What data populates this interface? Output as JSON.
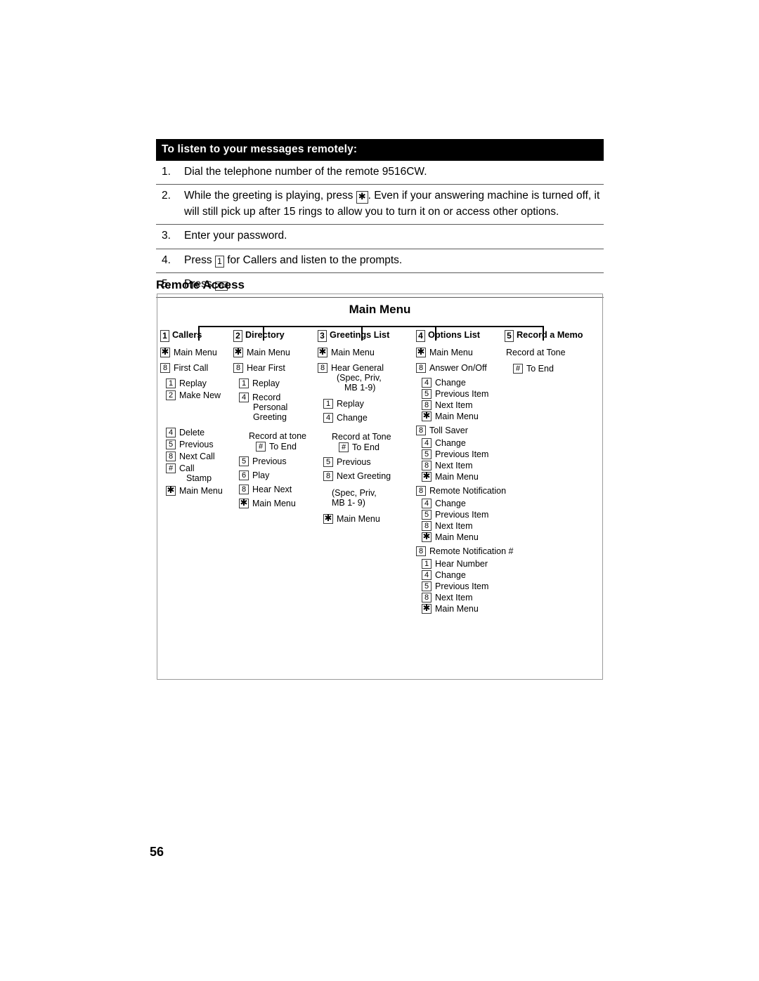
{
  "procedure": {
    "title": "To listen to your messages remotely:",
    "steps": [
      {
        "num": "1.",
        "pre": "Dial the telephone number of the remote 9516CW.",
        "key": "",
        "post": ""
      },
      {
        "num": "2.",
        "pre": "While the greeting is playing, press ",
        "key": "✱",
        "post": ".  Even if your answering machine is turned off, it will still pick up after 15 rings to allow you to turn it on or access other options."
      },
      {
        "num": "3.",
        "pre": "Enter your password.",
        "key": "",
        "post": ""
      },
      {
        "num": "4.",
        "pre": "Press ",
        "key": "1",
        "post": " for Callers and listen to the prompts."
      },
      {
        "num": "5.",
        "pre": "Press ",
        "key": "Rls",
        "post": "."
      }
    ]
  },
  "section": {
    "title": "Remote Access"
  },
  "diagram": {
    "root": "Main Menu",
    "columns": [
      {
        "key": "1",
        "head": "Callers",
        "items": [
          {
            "type": "entry",
            "key": "✱",
            "label": "Main Menu",
            "indent": 0,
            "gap": 8
          },
          {
            "type": "entry",
            "key": "8",
            "label": "First Call",
            "indent": 0,
            "gap": 8
          },
          {
            "type": "entry",
            "key": "1",
            "label": "Replay",
            "indent": 8,
            "gap": 3
          },
          {
            "type": "entry",
            "key": "2",
            "label": "Make New",
            "indent": 8,
            "gap": 3
          },
          {
            "type": "spacer",
            "height": 36
          },
          {
            "type": "entry",
            "key": "4",
            "label": "Delete",
            "indent": 8,
            "gap": 3
          },
          {
            "type": "entry",
            "key": "5",
            "label": "Previous",
            "indent": 8,
            "gap": 3
          },
          {
            "type": "entry",
            "key": "8",
            "label": "Next Call",
            "indent": 8,
            "gap": 3
          },
          {
            "type": "entry",
            "key": "#",
            "label": "Call",
            "indent": 8,
            "gap": 0
          },
          {
            "type": "plain",
            "text": "Stamp",
            "indent": 37,
            "gap": 4
          },
          {
            "type": "entry",
            "key": "✱",
            "label": "Main Menu",
            "indent": 8,
            "gap": 3
          }
        ]
      },
      {
        "key": "2",
        "head": "Directory",
        "items": [
          {
            "type": "entry",
            "key": "✱",
            "label": "Main Menu",
            "indent": 0,
            "gap": 8
          },
          {
            "type": "entry",
            "key": "8",
            "label": "Hear First",
            "indent": 0,
            "gap": 8
          },
          {
            "type": "entry",
            "key": "1",
            "label": "Replay",
            "indent": 8,
            "gap": 6
          },
          {
            "type": "entry",
            "key": "4",
            "label": "Record",
            "indent": 8,
            "gap": 0
          },
          {
            "type": "plain",
            "text": "Personal",
            "indent": 28,
            "gap": 0
          },
          {
            "type": "plain",
            "text": "Greeting",
            "indent": 28,
            "gap": 13
          },
          {
            "type": "plain",
            "text": "Record at tone",
            "indent": 22,
            "gap": 1
          },
          {
            "type": "entry",
            "key": "#",
            "label": "To End",
            "indent": 32,
            "gap": 7
          },
          {
            "type": "entry",
            "key": "5",
            "label": "Previous",
            "indent": 8,
            "gap": 6
          },
          {
            "type": "entry",
            "key": "6",
            "label": "Play",
            "indent": 8,
            "gap": 6
          },
          {
            "type": "entry",
            "key": "8",
            "label": "Hear Next",
            "indent": 8,
            "gap": 6
          },
          {
            "type": "entry",
            "key": "✱",
            "label": "Main Menu",
            "indent": 8,
            "gap": 0
          }
        ]
      },
      {
        "key": "3",
        "head": "Greetings List",
        "items": [
          {
            "type": "entry",
            "key": "✱",
            "label": "Main Menu",
            "indent": 0,
            "gap": 8
          },
          {
            "type": "entry",
            "key": "8",
            "label": "Hear General",
            "indent": 0,
            "gap": 0
          },
          {
            "type": "plain",
            "text": "(Spec, Priv,",
            "indent": 27,
            "gap": 0
          },
          {
            "type": "plain",
            "text": "MB 1-9)",
            "indent": 38,
            "gap": 9
          },
          {
            "type": "entry",
            "key": "1",
            "label": "Replay",
            "indent": 8,
            "gap": 6
          },
          {
            "type": "entry",
            "key": "4",
            "label": "Change",
            "indent": 8,
            "gap": 13
          },
          {
            "type": "plain",
            "text": "Record at Tone",
            "indent": 20,
            "gap": 1
          },
          {
            "type": "entry",
            "key": "#",
            "label": "To End",
            "indent": 30,
            "gap": 7
          },
          {
            "type": "entry",
            "key": "5",
            "label": "Previous",
            "indent": 8,
            "gap": 6
          },
          {
            "type": "entry",
            "key": "8",
            "label": "Next Greeting",
            "indent": 8,
            "gap": 10
          },
          {
            "type": "plain",
            "text": "(Spec, Priv,",
            "indent": 20,
            "gap": 0
          },
          {
            "type": "plain",
            "text": "MB 1- 9)",
            "indent": 20,
            "gap": 9
          },
          {
            "type": "entry",
            "key": "✱",
            "label": "Main Menu",
            "indent": 8,
            "gap": 0
          }
        ]
      },
      {
        "key": "4",
        "head": "Options List",
        "items": [
          {
            "type": "entry",
            "key": "✱",
            "label": "Main Menu",
            "indent": 0,
            "gap": 8
          },
          {
            "type": "entry",
            "key": "8",
            "label": "Answer On/Off",
            "indent": 0,
            "gap": 7
          },
          {
            "type": "entry",
            "key": "4",
            "label": "Change",
            "indent": 8,
            "gap": 2
          },
          {
            "type": "entry",
            "key": "5",
            "label": "Previous Item",
            "indent": 8,
            "gap": 2
          },
          {
            "type": "entry",
            "key": "8",
            "label": "Next Item",
            "indent": 8,
            "gap": 2
          },
          {
            "type": "entry",
            "key": "✱",
            "label": "Main Menu",
            "indent": 8,
            "gap": 6
          },
          {
            "type": "entry",
            "key": "8",
            "label": "Toll Saver",
            "indent": 0,
            "gap": 4
          },
          {
            "type": "entry",
            "key": "4",
            "label": "Change",
            "indent": 8,
            "gap": 2
          },
          {
            "type": "entry",
            "key": "5",
            "label": "Previous Item",
            "indent": 8,
            "gap": 2
          },
          {
            "type": "entry",
            "key": "8",
            "label": "Next Item",
            "indent": 8,
            "gap": 2
          },
          {
            "type": "entry",
            "key": "✱",
            "label": "Main Menu",
            "indent": 8,
            "gap": 6
          },
          {
            "type": "entry",
            "key": "8",
            "label": "Remote Notification",
            "indent": 0,
            "gap": 4
          },
          {
            "type": "entry",
            "key": "4",
            "label": "Change",
            "indent": 8,
            "gap": 2
          },
          {
            "type": "entry",
            "key": "5",
            "label": "Previous Item",
            "indent": 8,
            "gap": 2
          },
          {
            "type": "entry",
            "key": "8",
            "label": "Next Item",
            "indent": 8,
            "gap": 2
          },
          {
            "type": "entry",
            "key": "✱",
            "label": "Main Menu",
            "indent": 8,
            "gap": 6
          },
          {
            "type": "entry",
            "key": "8",
            "label": "Remote Notification #",
            "indent": 0,
            "gap": 4
          },
          {
            "type": "entry",
            "key": "1",
            "label": "Hear Number",
            "indent": 8,
            "gap": 2
          },
          {
            "type": "entry",
            "key": "4",
            "label": "Change",
            "indent": 8,
            "gap": 2
          },
          {
            "type": "entry",
            "key": "5",
            "label": "Previous Item",
            "indent": 8,
            "gap": 2
          },
          {
            "type": "entry",
            "key": "8",
            "label": "Next Item",
            "indent": 8,
            "gap": 2
          },
          {
            "type": "entry",
            "key": "✱",
            "label": "Main Menu",
            "indent": 8,
            "gap": 0
          }
        ]
      },
      {
        "key": "5",
        "head": "Record a Memo",
        "items": [
          {
            "type": "plain",
            "text": "Record at Tone",
            "indent": 2,
            "gap": 9
          },
          {
            "type": "entry",
            "key": "#",
            "label": "To End",
            "indent": 12,
            "gap": 0
          }
        ]
      }
    ]
  },
  "page": {
    "number": "56"
  },
  "colors": {
    "header_bg": "#000000",
    "header_fg": "#ffffff",
    "rule": "#5a5a5a",
    "box_border": "#9a9a9a"
  }
}
